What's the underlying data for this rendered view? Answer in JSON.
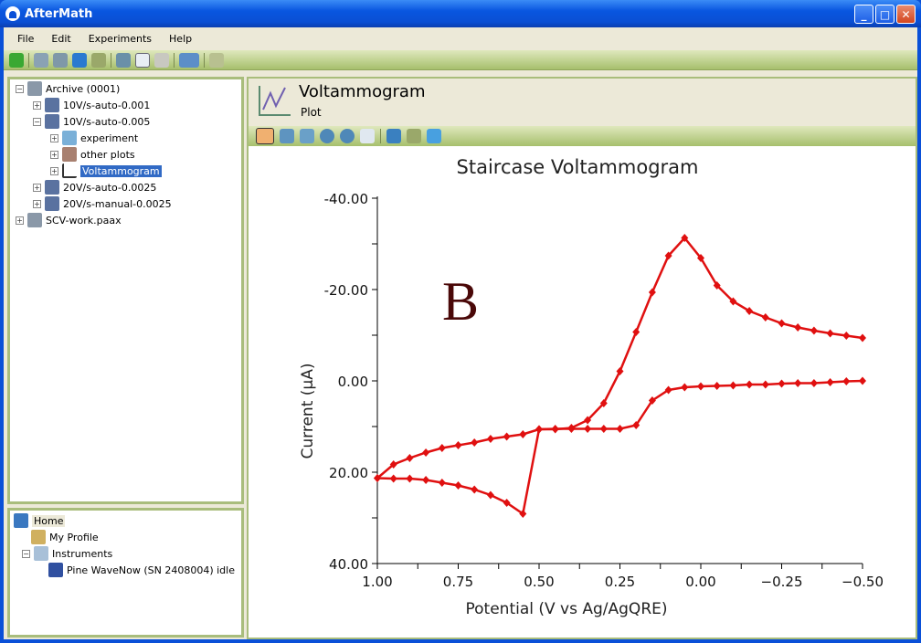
{
  "app": {
    "title": "AfterMath"
  },
  "menu": [
    "File",
    "Edit",
    "Experiments",
    "Help"
  ],
  "toolbar_icons": [
    "back-icon",
    "new-archive-icon",
    "open-archive-icon",
    "save-icon",
    "print-icon",
    "cut-icon",
    "copy-icon",
    "paste-icon",
    "wizard-icon",
    "favorite-icon"
  ],
  "tree": [
    {
      "label": "Archive (0001)",
      "icon": "archive-icon",
      "expanded": true
    },
    {
      "label": "10V/s-auto-0.001",
      "icon": "experiment-icon",
      "expanded": false
    },
    {
      "label": "10V/s-auto-0.005",
      "icon": "experiment-icon",
      "expanded": true
    },
    {
      "label": "experiment",
      "icon": "flask-icon",
      "expanded": false
    },
    {
      "label": "other plots",
      "icon": "folder-icon",
      "expanded": false
    },
    {
      "label": "Voltammogram",
      "icon": "plot-icon",
      "expanded": false,
      "selected": true
    },
    {
      "label": "20V/s-auto-0.0025",
      "icon": "experiment-icon",
      "expanded": false
    },
    {
      "label": "20V/s-manual-0.0025",
      "icon": "experiment-icon",
      "expanded": false
    },
    {
      "label": "SCV-work.paax",
      "icon": "archive-icon",
      "expanded": false
    }
  ],
  "home_tree": [
    {
      "label": "Home",
      "icon": "home-icon"
    },
    {
      "label": "My Profile",
      "icon": "profile-icon"
    },
    {
      "label": "Instruments",
      "icon": "instruments-icon"
    },
    {
      "label": "Pine WaveNow (SN 2408004) idle",
      "icon": "instrument-icon"
    }
  ],
  "plot_header": {
    "title": "Voltammogram",
    "subtitle": "Plot"
  },
  "plot_tools": [
    "select-arrow-icon",
    "select-point-icon",
    "select-line-icon",
    "zoom-in-icon",
    "zoom-out-icon",
    "pan-hand-icon",
    "zoom-box-icon",
    "print-icon",
    "home-icon"
  ],
  "chart_data": {
    "type": "line",
    "title": "Staircase Voltammogram",
    "xlabel": "Potential (V vs Ag/AgQRE)",
    "ylabel": "Current (µA)",
    "annotation": "B",
    "xlim": [
      1.0,
      -0.5
    ],
    "ylim": [
      -40,
      40
    ],
    "y_inverted": true,
    "x_ticks": [
      "1.00",
      "0.75",
      "0.50",
      "0.25",
      "0.00",
      "−0.25",
      "−0.50"
    ],
    "y_ticks": [
      "-40.00",
      "-20.00",
      "0.00",
      "20.00",
      "40.00"
    ],
    "color": "#e01010",
    "marker": "diamond",
    "x": [
      1.0,
      0.95,
      0.9,
      0.85,
      0.8,
      0.75,
      0.7,
      0.65,
      0.6,
      0.55,
      0.5,
      0.45,
      0.4,
      0.35,
      0.3,
      0.25,
      0.2,
      0.15,
      0.1,
      0.05,
      0.0,
      -0.05,
      -0.1,
      -0.15,
      -0.2,
      -0.25,
      -0.3,
      -0.35,
      -0.4,
      -0.45,
      -0.5
    ],
    "series": [
      {
        "values": [
          21.3,
          18.3,
          16.9,
          15.7,
          14.7,
          14.1,
          13.5,
          12.7,
          12.2,
          11.7,
          10.6,
          10.6,
          10.3,
          8.6,
          4.9,
          -2.1,
          -10.7,
          -19.4,
          -27.4,
          -31.3,
          -26.9,
          -20.9,
          -17.4,
          -15.3,
          -13.9,
          -12.6,
          -11.7,
          -11.0,
          -10.4,
          -9.9,
          -9.4
        ]
      },
      {
        "values": [
          21.3,
          21.4,
          21.4,
          21.7,
          22.3,
          22.9,
          23.8,
          25.0,
          26.7,
          29.1,
          10.6,
          10.5,
          10.5,
          10.5,
          10.5,
          10.5,
          9.7,
          4.3,
          2.0,
          1.4,
          1.2,
          1.1,
          1.0,
          0.8,
          0.8,
          0.6,
          0.5,
          0.5,
          0.3,
          0.1,
          0.0
        ]
      }
    ]
  }
}
